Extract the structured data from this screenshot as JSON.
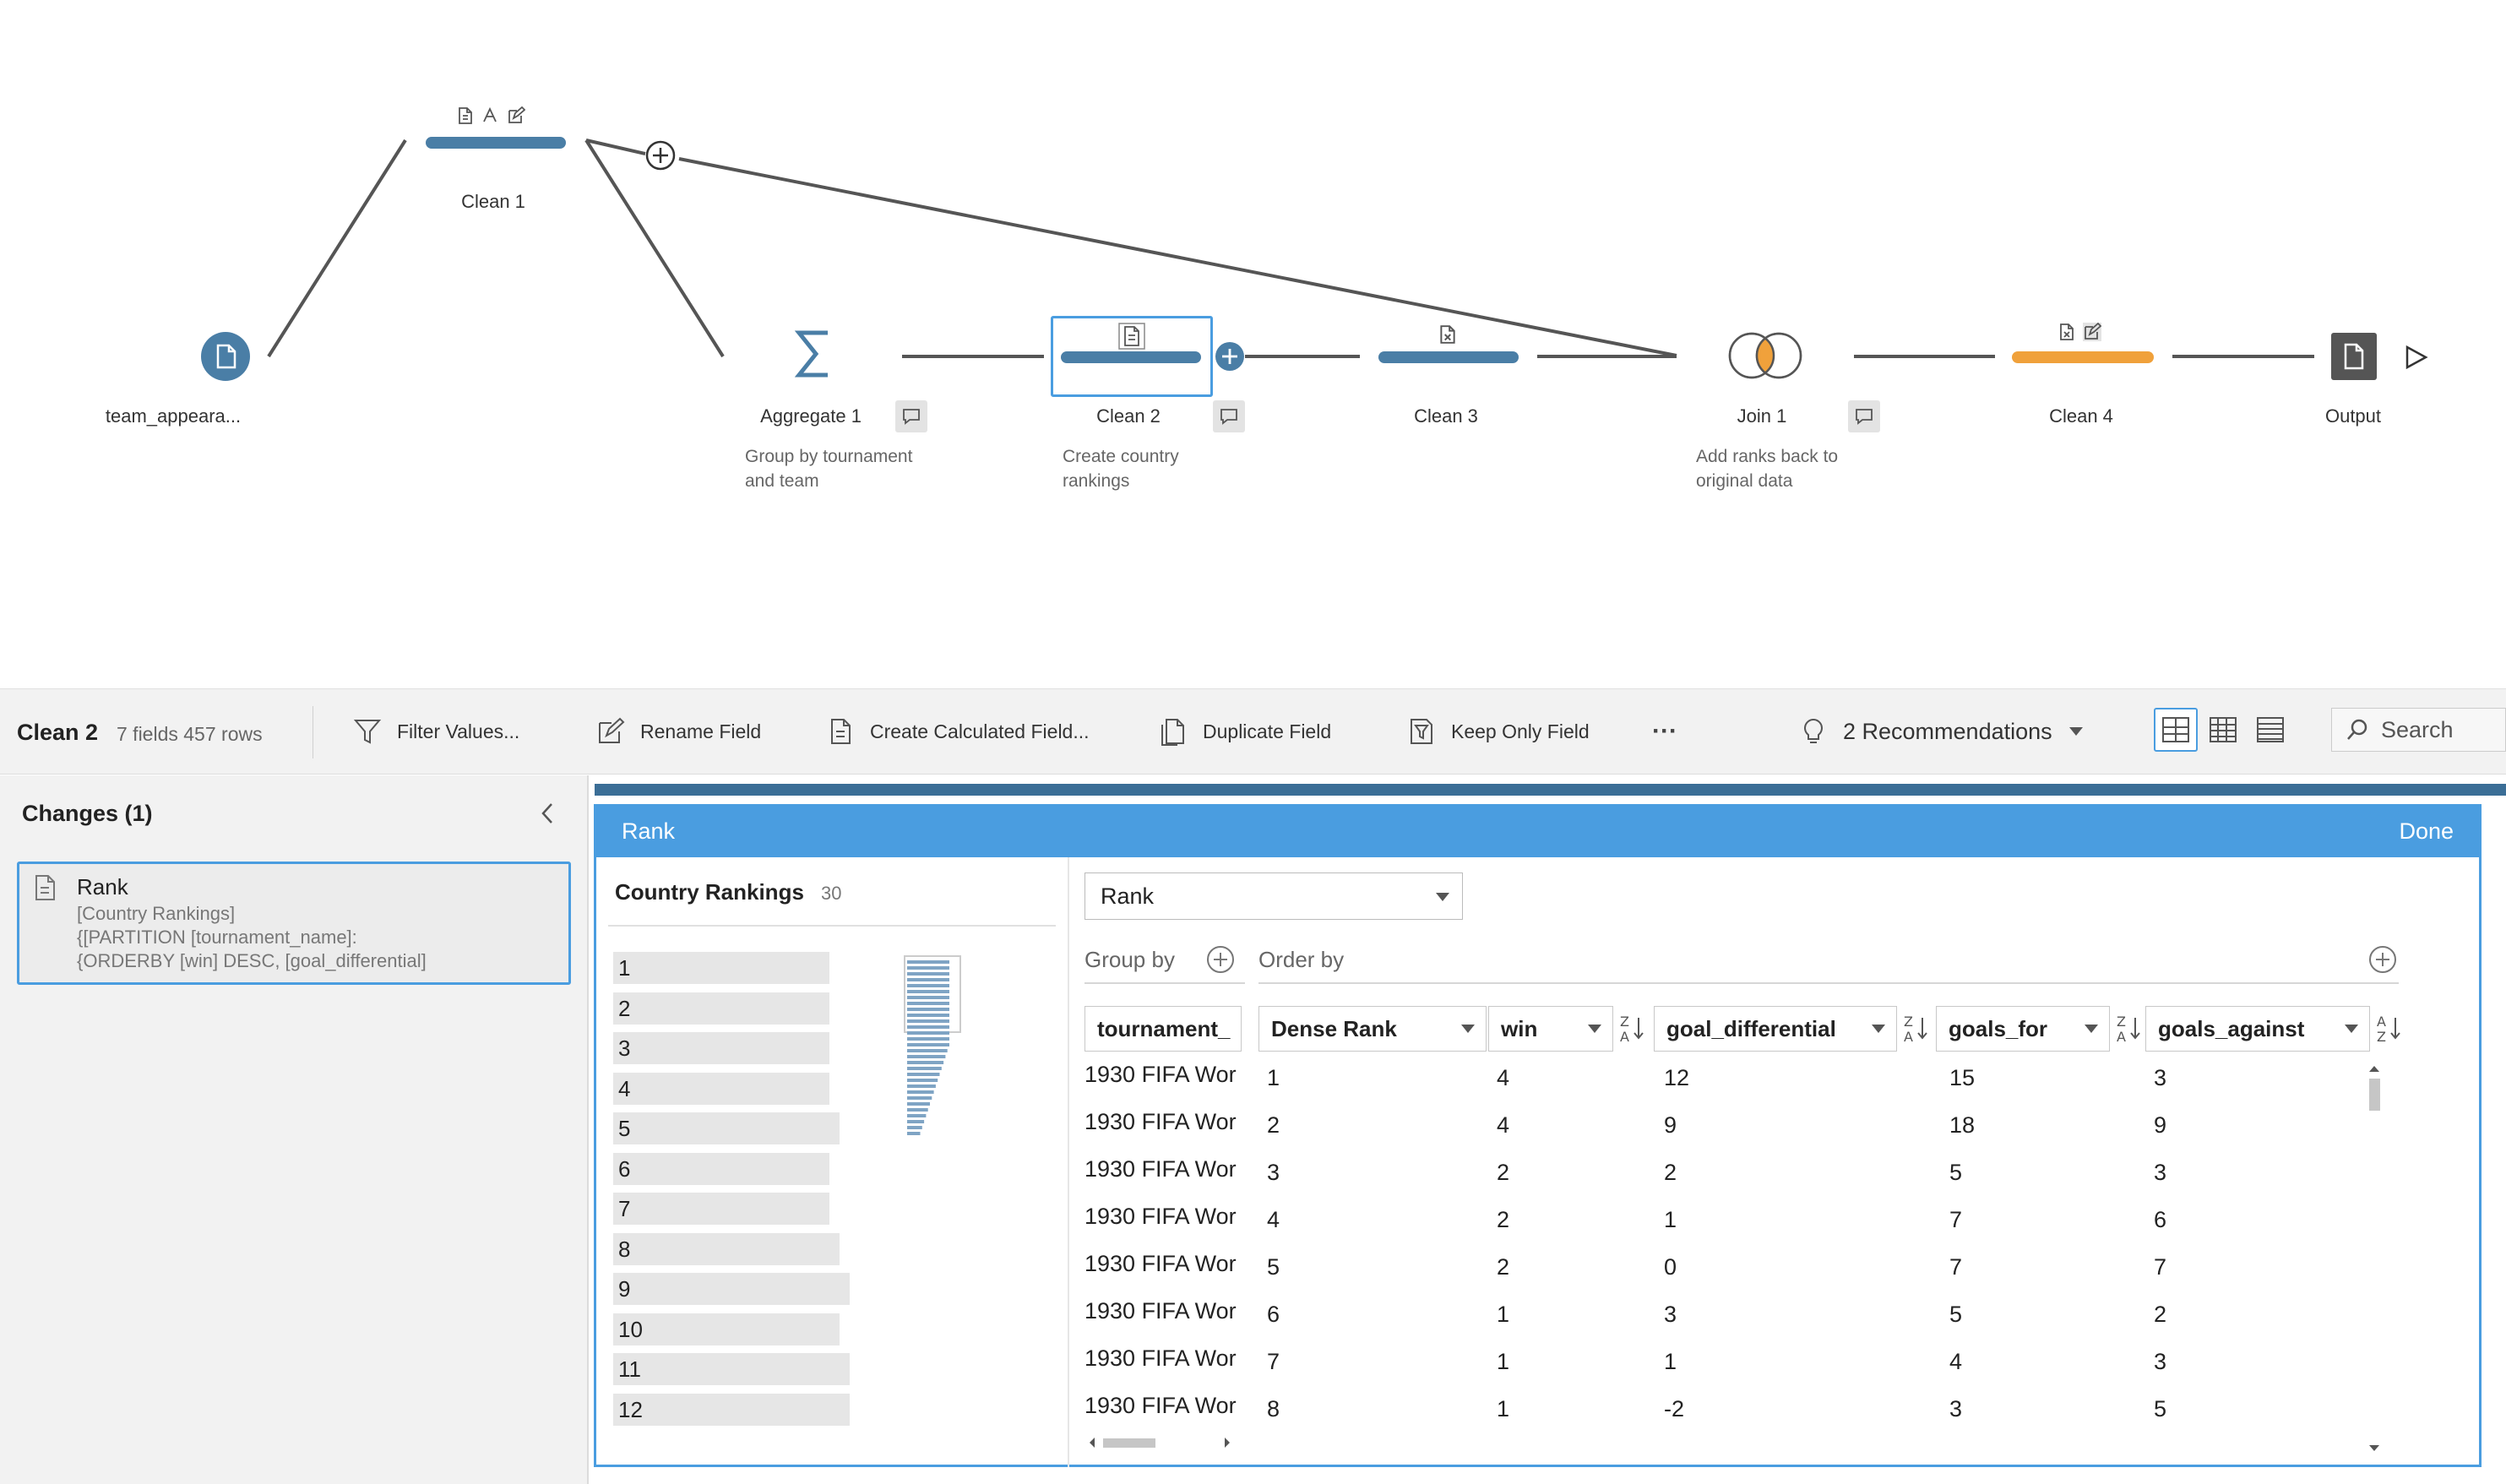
{
  "flow": {
    "nodes": {
      "input": {
        "label": "team_appeara..."
      },
      "clean1": {
        "label": "Clean 1"
      },
      "aggregate1": {
        "label": "Aggregate 1",
        "desc1": "Group by tournament",
        "desc2": "and team"
      },
      "clean2": {
        "label": "Clean 2",
        "desc1": "Create country",
        "desc2": "rankings"
      },
      "clean3": {
        "label": "Clean 3"
      },
      "join1": {
        "label": "Join 1",
        "desc1": "Add ranks back to",
        "desc2": "original data"
      },
      "clean4": {
        "label": "Clean 4"
      },
      "output": {
        "label": "Output"
      }
    },
    "colors": {
      "step": "#4a7ea6",
      "highlight": "#f0a13b",
      "select": "#4a9de0"
    }
  },
  "toolbar": {
    "step_name": "Clean 2",
    "meta": "7 fields  457 rows",
    "filter_label": "Filter Values...",
    "rename_label": "Rename Field",
    "calc_label": "Create Calculated Field...",
    "duplicate_label": "Duplicate Field",
    "keep_only_label": "Keep Only Field",
    "more_label": "···",
    "recommendations_label": "2 Recommendations",
    "search_placeholder": "Search"
  },
  "changes": {
    "header": "Changes (1)",
    "items": [
      {
        "title": "Rank",
        "line1": "[Country Rankings]",
        "line2": "{[PARTITION [tournament_name]:",
        "line3": "{ORDERBY [win] DESC, [goal_differential]"
      }
    ]
  },
  "editor": {
    "title": "Rank",
    "done_label": "Done",
    "profile": {
      "field_name": "Country Rankings",
      "count": "30",
      "values": [
        "1",
        "2",
        "3",
        "4",
        "5",
        "6",
        "7",
        "8",
        "9",
        "10",
        "11",
        "12"
      ],
      "bar_widths": [
        0.64,
        0.64,
        0.64,
        0.64,
        0.67,
        0.64,
        0.64,
        0.67,
        0.7,
        0.67,
        0.7,
        0.7
      ]
    },
    "calc": {
      "function": "Rank",
      "group_by_label": "Group by",
      "order_by_label": "Order by",
      "group_col": "tournament_",
      "rank_col": "Dense Rank",
      "order_cols": [
        "win",
        "goal_differential",
        "goals_for",
        "goals_against"
      ],
      "tournament_values": [
        "1930 FIFA Wor",
        "1930 FIFA Wor",
        "1930 FIFA Wor",
        "1930 FIFA Wor",
        "1930 FIFA Wor",
        "1930 FIFA Wor",
        "1930 FIFA Wor",
        "1930 FIFA Wor"
      ],
      "rows": [
        [
          "1",
          "4",
          "12",
          "15",
          "3"
        ],
        [
          "2",
          "4",
          "9",
          "18",
          "9"
        ],
        [
          "3",
          "2",
          "2",
          "5",
          "3"
        ],
        [
          "4",
          "2",
          "1",
          "7",
          "6"
        ],
        [
          "5",
          "2",
          "0",
          "7",
          "7"
        ],
        [
          "6",
          "1",
          "3",
          "5",
          "2"
        ],
        [
          "7",
          "1",
          "1",
          "4",
          "3"
        ],
        [
          "8",
          "1",
          "-2",
          "3",
          "5"
        ]
      ]
    }
  }
}
